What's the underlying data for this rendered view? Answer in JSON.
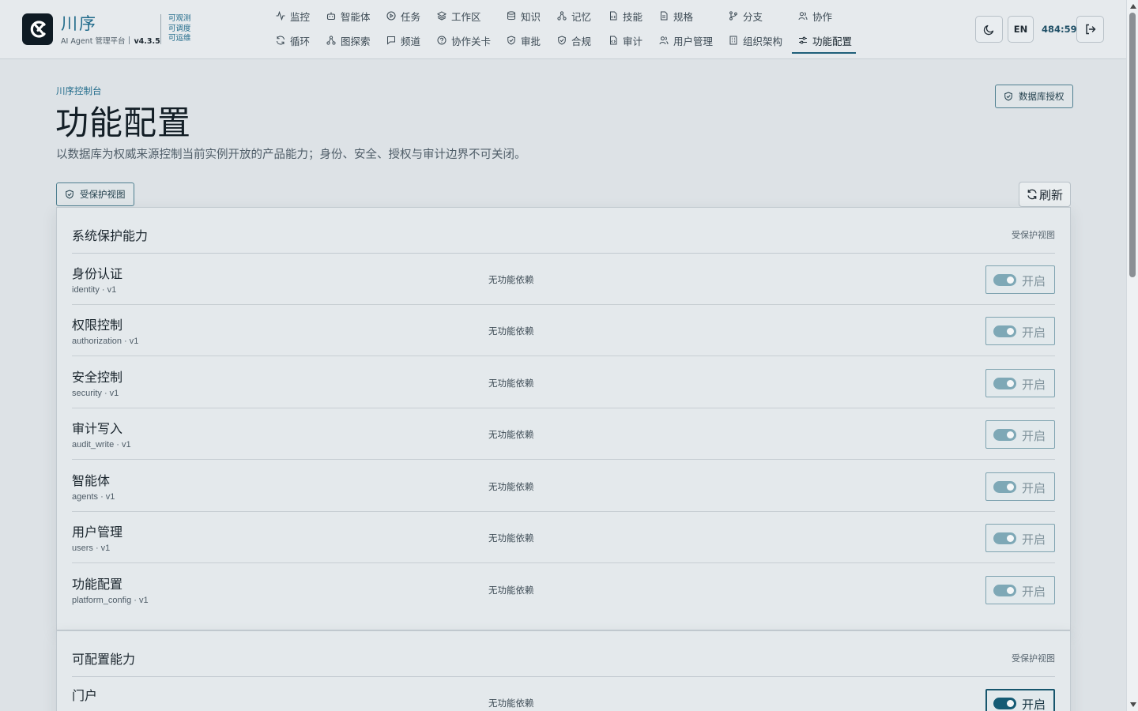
{
  "brand": {
    "name": "川序",
    "subtitle": "AI Agent 管理平台",
    "version": "v4.3.5",
    "tags": [
      "可观测",
      "可调度",
      "可运维"
    ]
  },
  "nav": {
    "row1": [
      {
        "label": "监控",
        "icon": "activity-icon"
      },
      {
        "label": "智能体",
        "icon": "bot-icon"
      },
      {
        "label": "任务",
        "icon": "play-circle-icon"
      },
      {
        "label": "工作区",
        "icon": "layers-icon"
      },
      {
        "label": "知识",
        "icon": "database-icon"
      },
      {
        "label": "记忆",
        "icon": "network-icon"
      },
      {
        "label": "技能",
        "icon": "file-code-icon"
      },
      {
        "label": "规格",
        "icon": "file-spec-icon"
      },
      {
        "label": "分支",
        "icon": "git-branch-icon"
      },
      {
        "label": "协作",
        "icon": "users-icon"
      }
    ],
    "row2": [
      {
        "label": "循环",
        "icon": "refresh-icon"
      },
      {
        "label": "图探索",
        "icon": "network-icon"
      },
      {
        "label": "频道",
        "icon": "message-icon"
      },
      {
        "label": "协作关卡",
        "icon": "help-circle-icon"
      },
      {
        "label": "审批",
        "icon": "shield-check-icon"
      },
      {
        "label": "合规",
        "icon": "shield-check-icon"
      },
      {
        "label": "审计",
        "icon": "file-code-icon"
      },
      {
        "label": "用户管理",
        "icon": "users-icon"
      },
      {
        "label": "组织架构",
        "icon": "building-icon"
      },
      {
        "label": "功能配置",
        "icon": "sliders-icon",
        "active": true
      }
    ]
  },
  "header_actions": {
    "theme_icon": "moon-icon",
    "lang": "EN",
    "clock": "484:59",
    "logout_icon": "logout-icon"
  },
  "page": {
    "breadcrumb": "川序控制台",
    "title": "功能配置",
    "description": "以数据库为权威来源控制当前实例开放的产品能力；身份、安全、授权与审计边界不可关闭。",
    "db_auth_button": "数据库授权",
    "protected_view_button": "受保护视图",
    "refresh_button": "刷新"
  },
  "sections": [
    {
      "title": "系统保护能力",
      "tag": "受保护视图",
      "rows": [
        {
          "name": "身份认证",
          "key": "identity · v1",
          "deps": "无功能依赖",
          "toggle": "开启",
          "enabled": true,
          "locked": true
        },
        {
          "name": "权限控制",
          "key": "authorization · v1",
          "deps": "无功能依赖",
          "toggle": "开启",
          "enabled": true,
          "locked": true
        },
        {
          "name": "安全控制",
          "key": "security · v1",
          "deps": "无功能依赖",
          "toggle": "开启",
          "enabled": true,
          "locked": true
        },
        {
          "name": "审计写入",
          "key": "audit_write · v1",
          "deps": "无功能依赖",
          "toggle": "开启",
          "enabled": true,
          "locked": true
        },
        {
          "name": "智能体",
          "key": "agents · v1",
          "deps": "无功能依赖",
          "toggle": "开启",
          "enabled": true,
          "locked": true
        },
        {
          "name": "用户管理",
          "key": "users · v1",
          "deps": "无功能依赖",
          "toggle": "开启",
          "enabled": true,
          "locked": true
        },
        {
          "name": "功能配置",
          "key": "platform_config · v1",
          "deps": "无功能依赖",
          "toggle": "开启",
          "enabled": true,
          "locked": true
        }
      ]
    },
    {
      "title": "可配置能力",
      "tag": "受保护视图",
      "rows": [
        {
          "name": "门户",
          "key": "",
          "deps": "无功能依赖",
          "toggle": "开启",
          "enabled": true,
          "locked": false
        }
      ]
    }
  ],
  "colors": {
    "accent": "#1f6a8a",
    "toggle_on": "#155b74",
    "toggle_locked": "#7ea8b6",
    "background": "#dde2e6"
  }
}
